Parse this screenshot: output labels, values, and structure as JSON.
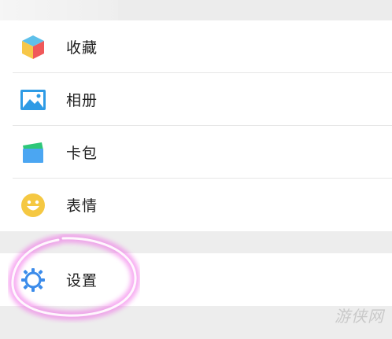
{
  "menu": {
    "items": [
      {
        "label": "收藏",
        "icon": "favorites-cube-icon"
      },
      {
        "label": "相册",
        "icon": "album-icon"
      },
      {
        "label": "卡包",
        "icon": "card-wallet-icon"
      },
      {
        "label": "表情",
        "icon": "sticker-smiley-icon"
      }
    ],
    "settings": {
      "label": "设置",
      "icon": "settings-gear-icon"
    }
  },
  "watermark": {
    "text": "游侠网"
  },
  "colors": {
    "highlight": "#e000c8",
    "background": "#ededed",
    "accent_blue": "#3b8bea",
    "smiley_yellow": "#f5c842"
  }
}
